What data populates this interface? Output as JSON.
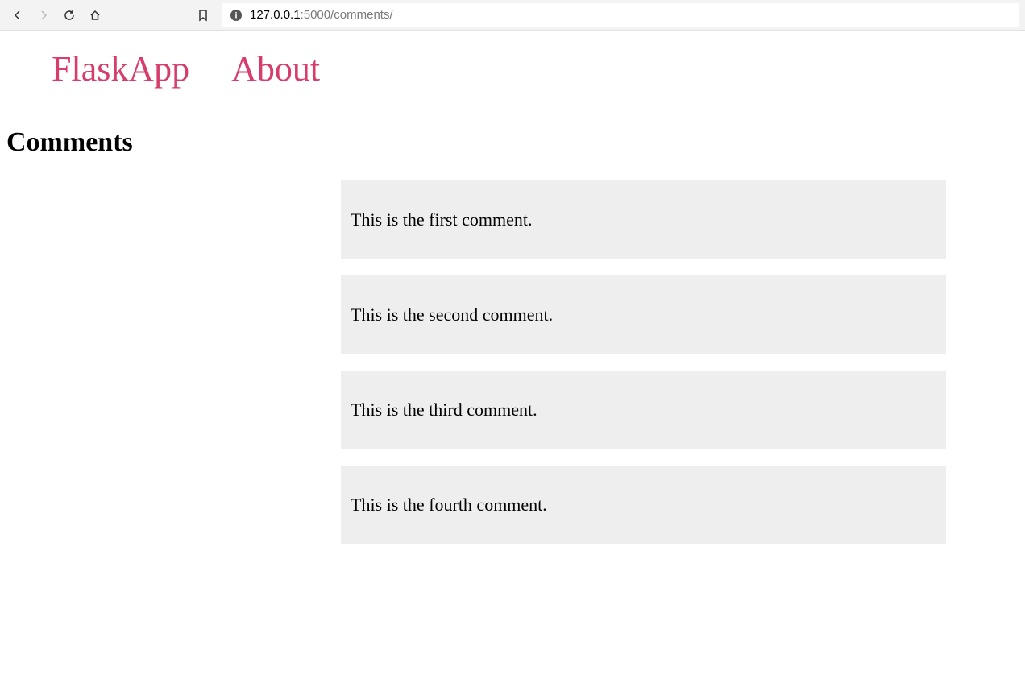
{
  "browser": {
    "url_host": "127.0.0.1",
    "url_port_path": ":5000/comments/"
  },
  "nav": {
    "brand": "FlaskApp",
    "about": "About"
  },
  "page": {
    "title": "Comments"
  },
  "comments": [
    "This is the first comment.",
    "This is the second comment.",
    "This is the third comment.",
    "This is the fourth comment."
  ]
}
